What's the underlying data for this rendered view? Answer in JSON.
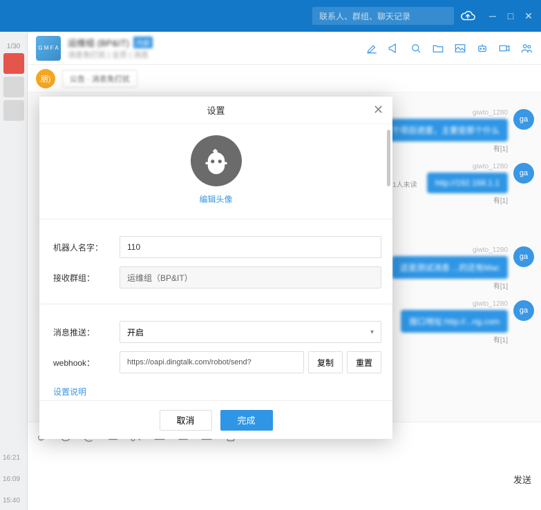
{
  "search": {
    "placeholder": "联系人、群组、聊天记录"
  },
  "header": {
    "group_name": "运维组 (BP&IT)",
    "badge": "内部",
    "subtitle": "消息免打扰 | 全员 | 消息"
  },
  "subbar": {
    "avatar_text": "朋)",
    "tag": "公告 · 消息免打扰"
  },
  "messages": {
    "m1": {
      "sender": "giwto_1280",
      "text": "看看这个项目进度，主要是那个什么",
      "status": "有[1]",
      "avatar": "ga"
    },
    "m2": {
      "sender": "giwto_1280",
      "text": "http://192.168.1.1",
      "status": "有[1]",
      "avatar": "ga",
      "unread": "1人未读"
    },
    "m3": {
      "sender": "giwto_1280",
      "text": "这是测试消息 ...的还有Mac",
      "status": "有[1]",
      "avatar": "ga"
    },
    "m4": {
      "sender": "giwto_1280",
      "text": "接口地址:http://...ng.com",
      "status": "有[1]",
      "avatar": "ga"
    }
  },
  "modal": {
    "title": "设置",
    "edit_avatar": "编辑头像",
    "labels": {
      "robot_name": "机器人名字：",
      "group": "接收群组：",
      "push": "消息推送：",
      "webhook": "webhook："
    },
    "values": {
      "robot_name": "110",
      "group": "运维组（BP&IT）",
      "push": "开启",
      "webhook": "https://oapi.dingtalk.com/robot/send?"
    },
    "buttons": {
      "copy": "复制",
      "reset": "重置",
      "cancel": "取消",
      "finish": "完成"
    },
    "settings_link": "设置说明"
  },
  "send_button": "发送",
  "sidebar_times": {
    "t1": "16:21",
    "t2": "16:09",
    "t3": "15:40"
  },
  "top_time": "1/30"
}
